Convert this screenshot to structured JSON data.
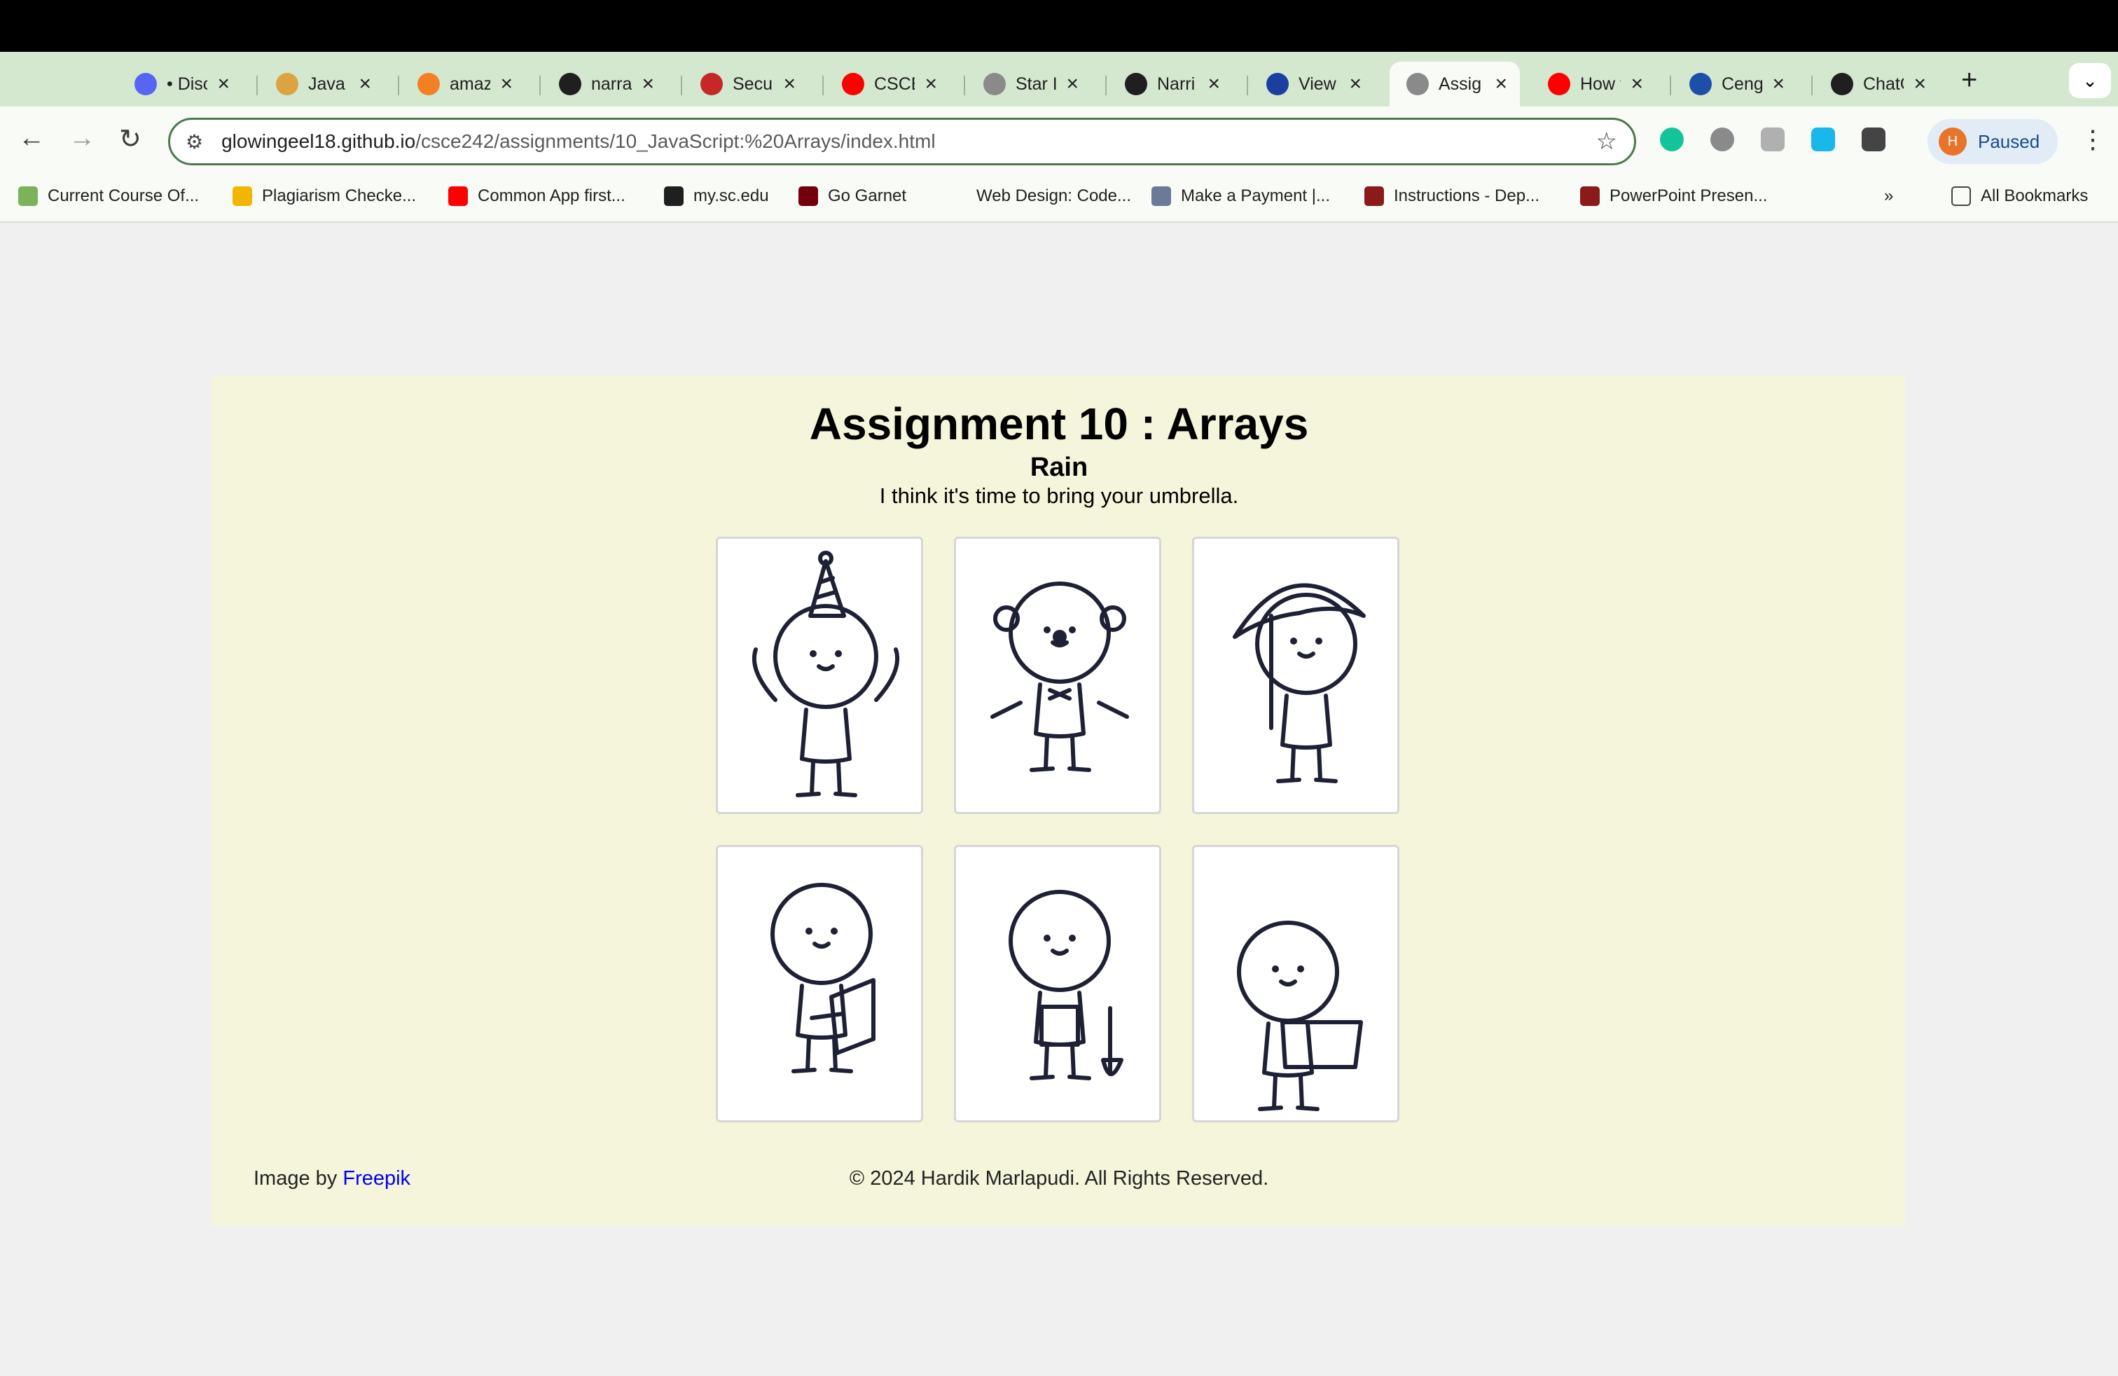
{
  "browser": {
    "tabs": [
      {
        "title": "• Disc",
        "icon": "discord-icon",
        "color": "#5865f2"
      },
      {
        "title": "Java",
        "icon": "box-icon",
        "color": "#d9a441"
      },
      {
        "title": "amaz",
        "icon": "stack-icon",
        "color": "#f48024"
      },
      {
        "title": "narra",
        "icon": "github-icon",
        "color": "#1f1f1f"
      },
      {
        "title": "Secu",
        "icon": "doc-icon",
        "color": "#c62828"
      },
      {
        "title": "CSCE",
        "icon": "youtube-icon",
        "color": "#ff0000"
      },
      {
        "title": "Star I",
        "icon": "globe-icon",
        "color": "#8a8a8a"
      },
      {
        "title": "Narri",
        "icon": "github-icon",
        "color": "#1f1f1f"
      },
      {
        "title": "View",
        "icon": "a-icon",
        "color": "#1a3fa0"
      },
      {
        "title": "Assig",
        "icon": "globe-icon",
        "color": "#8a8a8a",
        "active": true
      },
      {
        "title": "How t",
        "icon": "youtube-icon",
        "color": "#ff0000"
      },
      {
        "title": "Ceng",
        "icon": "cengage-icon",
        "color": "#1d4fa8"
      },
      {
        "title": "ChatC",
        "icon": "openai-icon",
        "color": "#1f1f1f"
      }
    ],
    "url_host": "glowingeel18.github.io",
    "url_path": "/csce242/assignments/10_JavaScript:%20Arrays/index.html",
    "profile_initial": "H",
    "profile_status": "Paused",
    "bookmarks": [
      {
        "label": "Current Course Of...",
        "color": "#7cb35a"
      },
      {
        "label": "Plagiarism Checke...",
        "color": "#f2b600"
      },
      {
        "label": "Common App first...",
        "color": "#ff0000"
      },
      {
        "label": "my.sc.edu",
        "color": "#1f1f1f"
      },
      {
        "label": "Go Garnet",
        "color": "#73000a"
      },
      {
        "label": "Web Design: Code...",
        "color": "#f8fbf6"
      },
      {
        "label": "Make a Payment |...",
        "color": "#6b7a99"
      },
      {
        "label": "Instructions - Dep...",
        "color": "#8b1a1a"
      },
      {
        "label": "PowerPoint Presen...",
        "color": "#8b1a1a"
      }
    ],
    "all_bookmarks": "All Bookmarks"
  },
  "page": {
    "title": "Assignment 10 : Arrays",
    "subtitle": "Rain",
    "message": "I think it's time to bring your umbrella.",
    "images": [
      {
        "name": "party-hat-character"
      },
      {
        "name": "clown-character"
      },
      {
        "name": "umbrella-character"
      },
      {
        "name": "reading-character"
      },
      {
        "name": "gardener-character"
      },
      {
        "name": "laptop-character"
      }
    ],
    "credit_prefix": "Image by",
    "credit_link": "Freepik",
    "copyright": "© 2024 Hardik Marlapudi. All Rights Reserved."
  }
}
